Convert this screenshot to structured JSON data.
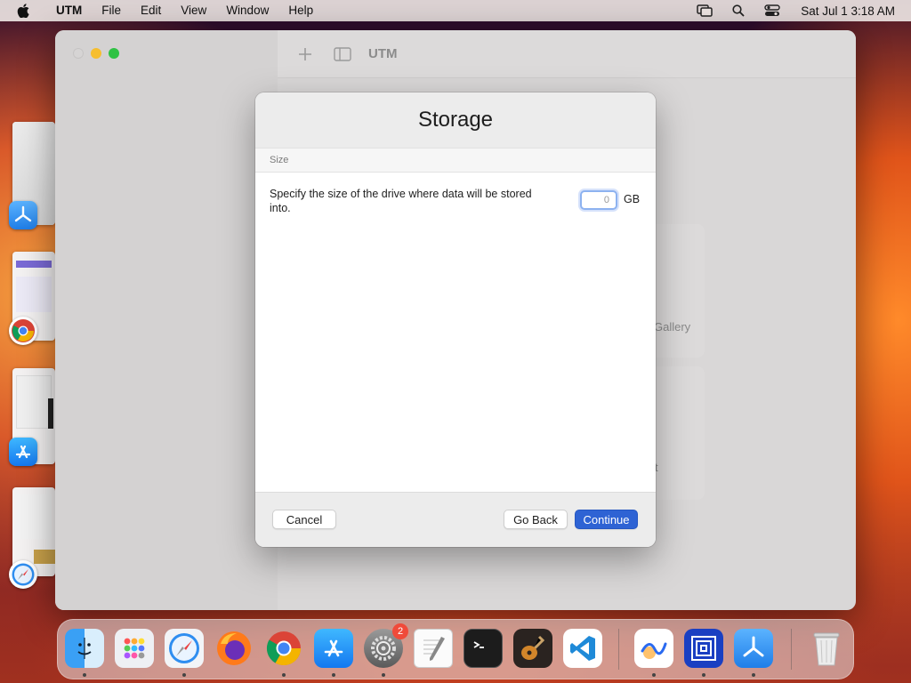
{
  "menubar": {
    "items": [
      "UTM",
      "File",
      "Edit",
      "View",
      "Window",
      "Help"
    ],
    "clock": "Sat Jul 1  3:18 AM"
  },
  "window": {
    "title": "UTM",
    "bg_gallery_text": "Gallery",
    "bg_partial_text": "t"
  },
  "dialog": {
    "title": "Storage",
    "section": "Size",
    "description": "Specify the size of the drive where data will be stored into.",
    "size_value": "0",
    "unit": "GB",
    "cancel_label": "Cancel",
    "back_label": "Go Back",
    "continue_label": "Continue"
  },
  "dock": {
    "settings_badge": "2"
  },
  "colors": {
    "accent": "#2e63d4",
    "focus_ring": "#8db2f0",
    "badge": "#f04a3a"
  }
}
